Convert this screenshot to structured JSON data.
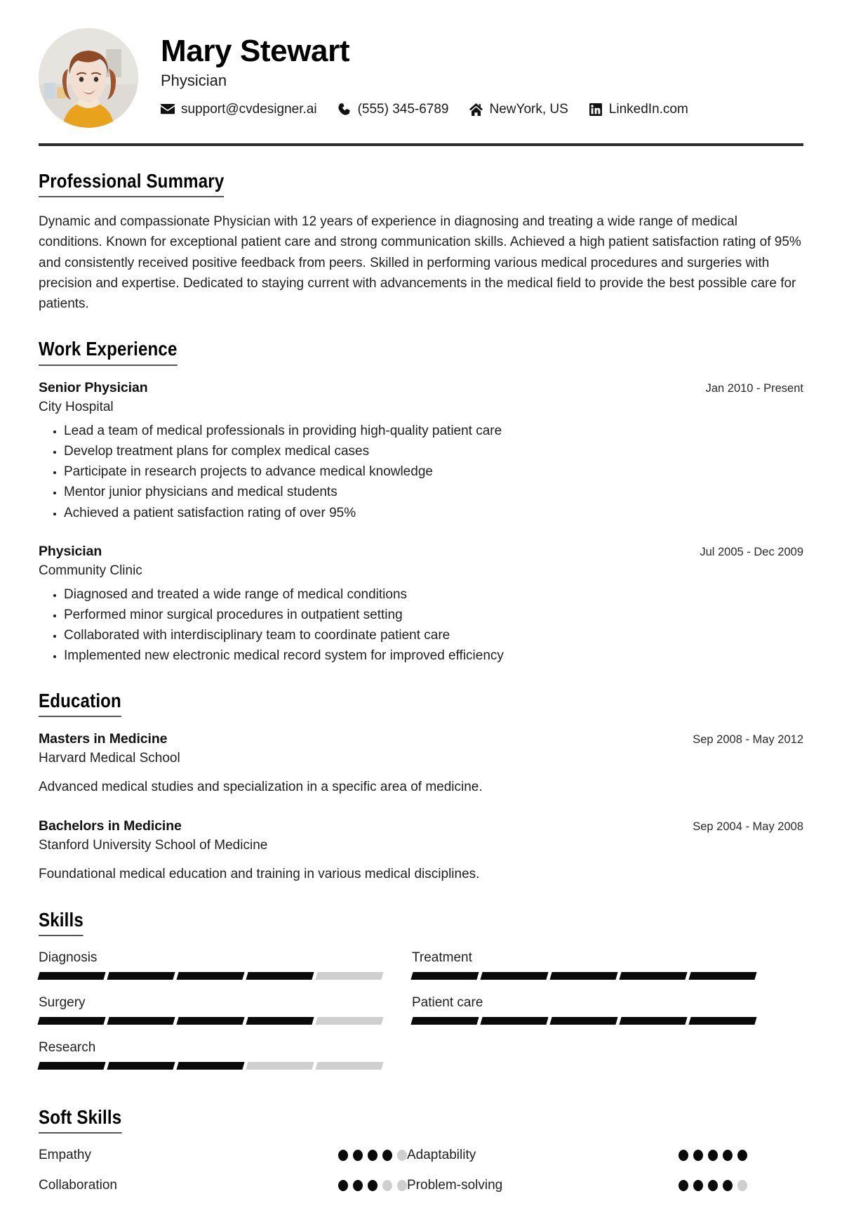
{
  "header": {
    "name": "Mary Stewart",
    "job_title": "Physician",
    "avatar_alt": "profile-photo",
    "contacts": [
      {
        "icon": "envelope-icon",
        "label": "support@cvdesigner.ai"
      },
      {
        "icon": "phone-icon",
        "label": "(555) 345-6789"
      },
      {
        "icon": "home-icon",
        "label": "NewYork, US"
      },
      {
        "icon": "linkedin-icon",
        "label": "LinkedIn.com"
      }
    ]
  },
  "summary": {
    "heading": "Professional Summary",
    "text": "Dynamic and compassionate Physician with 12 years of experience in diagnosing and treating a wide range of medical conditions. Known for exceptional patient care and strong communication skills. Achieved a high patient satisfaction rating of 95% and consistently received positive feedback from peers. Skilled in performing various medical procedures and surgeries with precision and expertise. Dedicated to staying current with advancements in the medical field to provide the best possible care for patients."
  },
  "work": {
    "heading": "Work Experience",
    "entries": [
      {
        "title": "Senior Physician",
        "organization": "City Hospital",
        "date": "Jan 2010 - Present",
        "bullets": [
          "Lead a team of medical professionals in providing high-quality patient care",
          "Develop treatment plans for complex medical cases",
          "Participate in research projects to advance medical knowledge",
          "Mentor junior physicians and medical students",
          "Achieved a patient satisfaction rating of over 95%"
        ]
      },
      {
        "title": "Physician",
        "organization": "Community Clinic",
        "date": "Jul 2005 - Dec 2009",
        "bullets": [
          "Diagnosed and treated a wide range of medical conditions",
          "Performed minor surgical procedures in outpatient setting",
          "Collaborated with interdisciplinary team to coordinate patient care",
          "Implemented new electronic medical record system for improved efficiency"
        ]
      }
    ]
  },
  "education": {
    "heading": "Education",
    "entries": [
      {
        "title": "Masters in Medicine",
        "organization": "Harvard Medical School",
        "date": "Sep 2008 - May 2012",
        "description": "Advanced medical studies and specialization in a specific area of medicine."
      },
      {
        "title": "Bachelors in Medicine",
        "organization": "Stanford University School of Medicine",
        "date": "Sep 2004 - May 2008",
        "description": "Foundational medical education and training in various medical disciplines."
      }
    ]
  },
  "skills": {
    "heading": "Skills",
    "max": 5,
    "items": [
      {
        "label": "Diagnosis",
        "level": 4
      },
      {
        "label": "Treatment",
        "level": 5
      },
      {
        "label": "Surgery",
        "level": 4
      },
      {
        "label": "Patient care",
        "level": 5
      },
      {
        "label": "Research",
        "level": 3
      }
    ]
  },
  "soft_skills": {
    "heading": "Soft Skills",
    "max": 5,
    "items": [
      {
        "label": "Empathy",
        "level": 4
      },
      {
        "label": "Adaptability",
        "level": 5
      },
      {
        "label": "Collaboration",
        "level": 3
      },
      {
        "label": "Problem-solving",
        "level": 4
      }
    ]
  },
  "colors": {
    "accent": "#0a0a0a",
    "muted": "#cfcfcf",
    "rule": "#2b2b2b"
  }
}
